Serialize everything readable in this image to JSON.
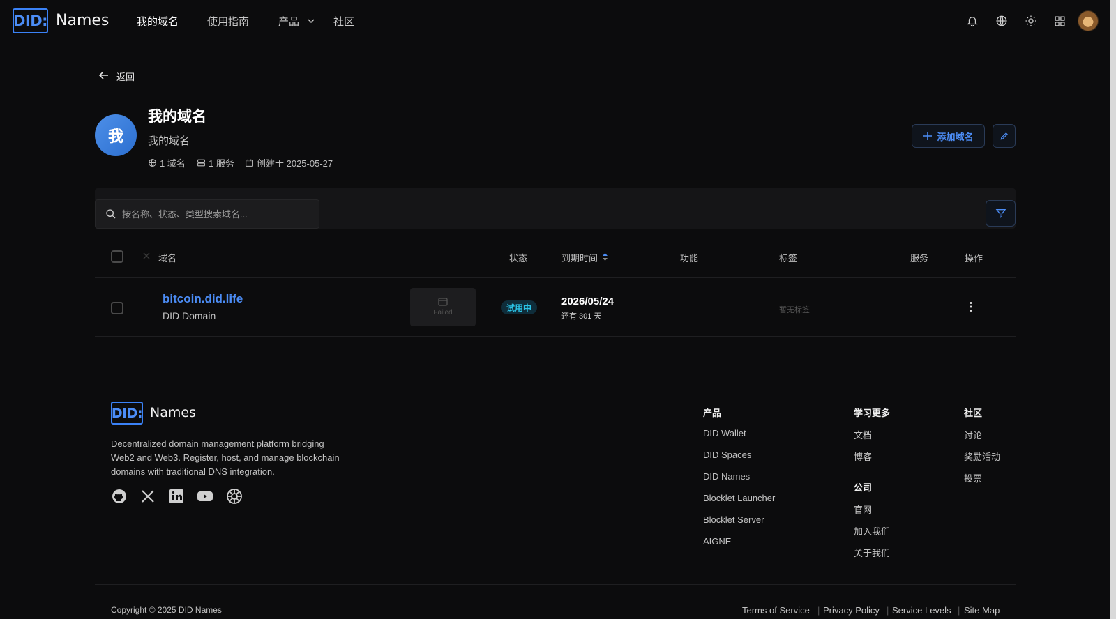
{
  "header": {
    "logo_box": "DID:",
    "logo_text": "Names",
    "nav": [
      {
        "label": "我的域名"
      },
      {
        "label": "使用指南"
      },
      {
        "label": "产品"
      },
      {
        "label": "社区"
      }
    ]
  },
  "back": {
    "label": "返回"
  },
  "profile": {
    "avatar_char": "我",
    "title": "我的域名",
    "subtitle": "我的域名",
    "domains_count": "1 域名",
    "services_count": "1 服务",
    "created": "创建于 2025-05-27",
    "add_button": "添加域名"
  },
  "search": {
    "placeholder": "按名称、状态、类型搜索域名..."
  },
  "table": {
    "headers": {
      "domain": "域名",
      "status": "状态",
      "expiry": "到期时间",
      "features": "功能",
      "tags": "标签",
      "services": "服务",
      "actions": "操作"
    },
    "rows": [
      {
        "name": "bitcoin.did.life",
        "type": "DID Domain",
        "preview_status": "Failed",
        "status": "试用中",
        "expiry_date": "2026/05/24",
        "expiry_remaining": "还有 301 天",
        "tags": "暂无标签"
      }
    ]
  },
  "footer": {
    "logo_box": "DID:",
    "logo_text": "Names",
    "description_lines": [
      "Decentralized domain management platform bridging",
      "Web2 and Web3. Register, host, and manage blockchain",
      "domains with traditional DNS integration."
    ],
    "social_icons": [
      "github-icon",
      "x-icon",
      "linkedin-icon",
      "youtube-icon",
      "community-icon"
    ],
    "columns": {
      "products": {
        "heading": "产品",
        "links": [
          "DID Wallet",
          "DID Spaces",
          "DID Names",
          "Blocklet Launcher",
          "Blocklet Server",
          "AIGNE"
        ]
      },
      "learn": {
        "heading": "学习更多",
        "links": [
          "文档",
          "博客"
        ]
      },
      "company": {
        "heading": "公司",
        "links": [
          "官网",
          "加入我们",
          "关于我们"
        ]
      },
      "community": {
        "heading": "社区",
        "links": [
          "讨论",
          "奖励活动",
          "投票"
        ]
      }
    },
    "copyright": "Copyright © 2025 DID Names",
    "legal_links": [
      "Terms of Service",
      "Privacy Policy",
      "Service Levels",
      "Site Map"
    ]
  },
  "colors": {
    "accent": "#4c8df6",
    "status": "#2bc3e6",
    "background": "#0c0c0d"
  }
}
